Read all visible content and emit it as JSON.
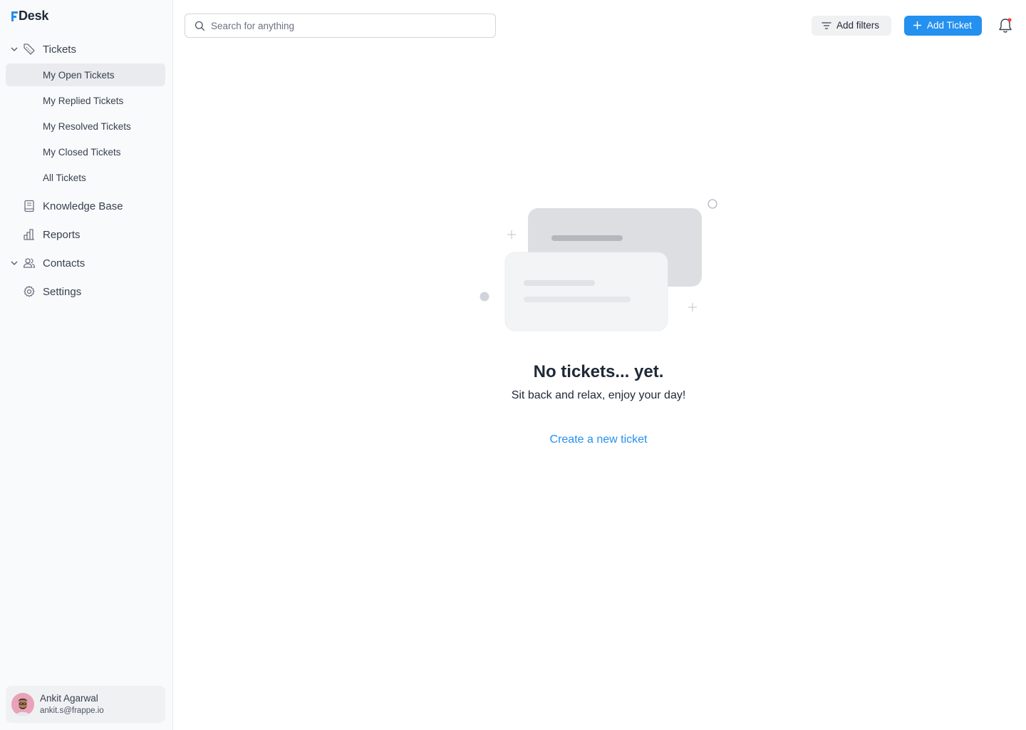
{
  "app": {
    "logo_text": "Desk"
  },
  "sidebar": {
    "tickets_label": "Tickets",
    "tickets_sub": [
      {
        "label": "My Open Tickets",
        "active": true
      },
      {
        "label": "My Replied Tickets"
      },
      {
        "label": "My Resolved Tickets"
      },
      {
        "label": "My Closed Tickets"
      },
      {
        "label": "All Tickets"
      }
    ],
    "knowledge_base_label": "Knowledge Base",
    "reports_label": "Reports",
    "contacts_label": "Contacts",
    "settings_label": "Settings"
  },
  "user": {
    "name": "Ankit Agarwal",
    "email": "ankit.s@frappe.io"
  },
  "header": {
    "search_placeholder": "Search for anything",
    "filter_label": "Add filters",
    "add_ticket_label": "Add Ticket"
  },
  "empty_state": {
    "title": "No tickets... yet.",
    "subtitle": "Sit back and relax, enjoy your day!",
    "link": "Create a new ticket"
  },
  "colors": {
    "accent": "#2490ef",
    "notification_dot": "#ef4444",
    "sidebar_bg": "#f9fafb"
  }
}
